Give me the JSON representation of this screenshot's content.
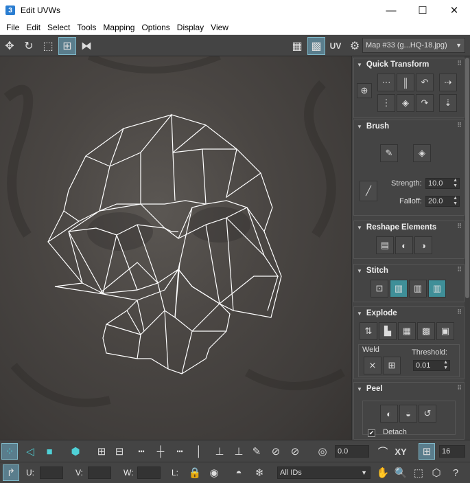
{
  "window": {
    "icon_label": "3",
    "title": "Edit UVWs",
    "minimize": "—",
    "maximize": "☐",
    "close": "✕"
  },
  "menu": [
    "File",
    "Edit",
    "Select",
    "Tools",
    "Mapping",
    "Options",
    "Display",
    "View"
  ],
  "toolbar": {
    "uv_label": "UV",
    "map_dropdown": "Map #33 (g...HQ-18.jpg)"
  },
  "panel": {
    "quick_transform": {
      "title": "Quick Transform"
    },
    "brush": {
      "title": "Brush",
      "strength_label": "Strength:",
      "strength_value": "10.0",
      "falloff_label": "Falloff:",
      "falloff_value": "20.0"
    },
    "reshape": {
      "title": "Reshape Elements"
    },
    "stitch": {
      "title": "Stitch"
    },
    "explode": {
      "title": "Explode",
      "weld_label": "Weld",
      "threshold_label": "Threshold:",
      "threshold_value": "0.01"
    },
    "peel": {
      "title": "Peel",
      "detach_label": "Detach"
    }
  },
  "bottom": {
    "rotate_value": "0.0",
    "xy_label": "XY",
    "grid_value": "16",
    "u_label": "U:",
    "v_label": "V:",
    "w_label": "W:",
    "l_label": "L:",
    "ids_dropdown": "All IDs"
  },
  "colors": {
    "accent": "#4fd0d6",
    "panel_bg": "#444444",
    "viewport_bg": "#4a4643",
    "wire": "#ffffff"
  }
}
